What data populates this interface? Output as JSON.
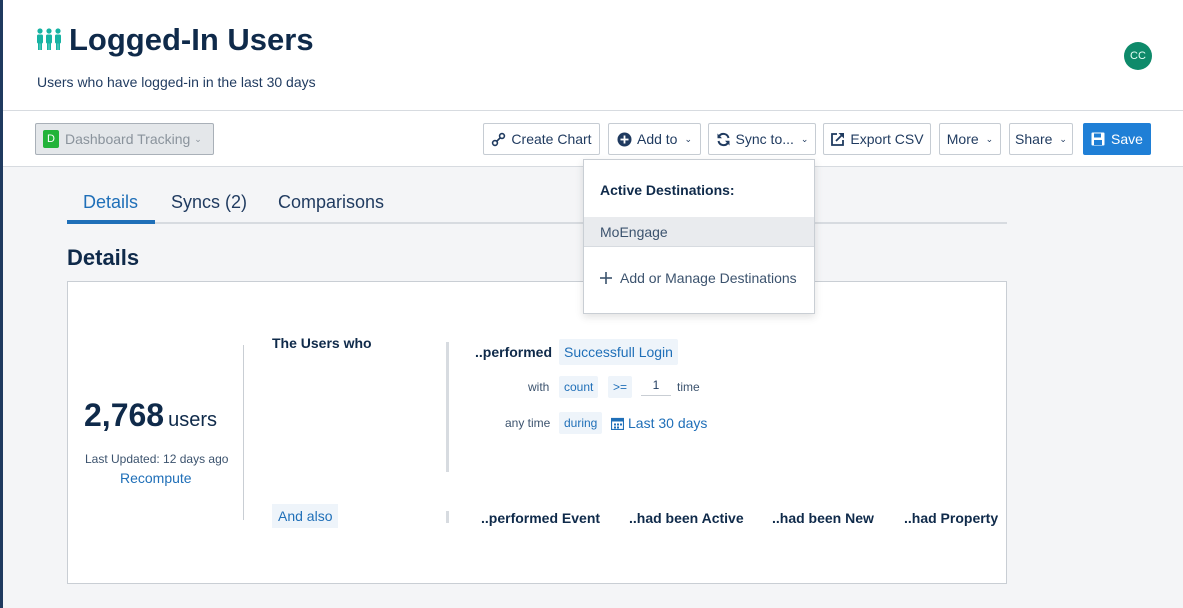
{
  "header": {
    "title": "Logged-In Users",
    "subtitle": "Users who have logged-in in the last 30 days",
    "avatar_initials": "CC",
    "title_icon": "users-group-icon"
  },
  "toolbar": {
    "dashboard_badge": "D",
    "dashboard_label": "Dashboard Tracking",
    "create_chart": "Create Chart",
    "add_to": "Add to",
    "sync_to": "Sync to...",
    "export_csv": "Export CSV",
    "more": "More",
    "share": "Share",
    "save": "Save"
  },
  "tabs": [
    "Details",
    "Syncs (2)",
    "Comparisons"
  ],
  "section_title": "Details",
  "summary": {
    "count": "2,768",
    "unit": "users",
    "last_updated": "Last Updated: 12 days ago",
    "recompute": "Recompute"
  },
  "definition": {
    "users_who": "The Users who",
    "performed": "..performed",
    "event": "Successfull Login",
    "with_label": "with",
    "count_label": "count",
    "operator": ">=",
    "count_value": "1",
    "time_label": "time",
    "any_time_label": "any time",
    "during_label": "during",
    "range": "Last 30 days",
    "and_also": "And also",
    "options": [
      "..performed Event",
      "..had been Active",
      "..had been New",
      "..had Property"
    ]
  },
  "sync_dropdown": {
    "heading": "Active Destinations:",
    "items": [
      "MoEngage"
    ],
    "add_manage": "Add or Manage Destinations"
  },
  "colors": {
    "accent": "#1f7fd6",
    "link": "#1f6fb8",
    "title_icon": "#17b3a3",
    "avatar": "#0e8a6a",
    "dashboard_badge": "#23b33a"
  }
}
